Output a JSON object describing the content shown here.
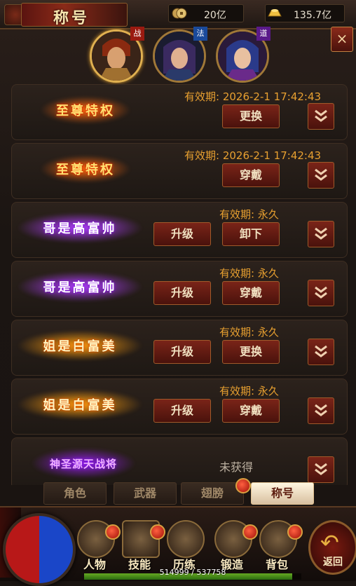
{
  "header": {
    "title": "称号",
    "currencies": [
      {
        "icon": "coin-icon",
        "value": "20亿"
      },
      {
        "icon": "gold-ingot-icon",
        "value": "135.7亿"
      }
    ]
  },
  "characters": [
    {
      "class_tag": "战",
      "tag_color": "#9a1a10",
      "selected": true
    },
    {
      "class_tag": "法",
      "tag_color": "#1a4a9a",
      "selected": false
    },
    {
      "class_tag": "道",
      "tag_color": "#5a1a8a",
      "selected": false
    }
  ],
  "close_label": "×",
  "titles": [
    {
      "badge": "至尊特权",
      "badge_color": "#ff9a20",
      "validity": "有效期: 2026-2-1 17:42:43",
      "upgrade": "",
      "action": "更换",
      "status": ""
    },
    {
      "badge": "至尊特权",
      "badge_color": "#ff9a20",
      "validity": "有效期: 2026-2-1 17:42:43",
      "upgrade": "",
      "action": "穿戴",
      "status": ""
    },
    {
      "badge": "哥是高富帅",
      "badge_color": "#c060ff",
      "validity": "有效期: 永久",
      "upgrade": "升级",
      "action": "卸下",
      "status": ""
    },
    {
      "badge": "哥是高富帅",
      "badge_color": "#c060ff",
      "validity": "有效期: 永久",
      "upgrade": "升级",
      "action": "穿戴",
      "status": ""
    },
    {
      "badge": "姐是白富美",
      "badge_color": "#ffb020",
      "validity": "有效期: 永久",
      "upgrade": "升级",
      "action": "更换",
      "status": ""
    },
    {
      "badge": "姐是白富美",
      "badge_color": "#ffb020",
      "validity": "有效期: 永久",
      "upgrade": "升级",
      "action": "穿戴",
      "status": ""
    },
    {
      "badge": "神圣源天战将",
      "badge_color": "#c040ff",
      "validity": "",
      "upgrade": "",
      "action": "",
      "status": "未获得"
    }
  ],
  "tabs": [
    {
      "label": "角色",
      "active": false
    },
    {
      "label": "武器",
      "active": false
    },
    {
      "label": "翅膀",
      "active": false,
      "alert": true
    },
    {
      "label": "称号",
      "active": true
    }
  ],
  "menu": [
    {
      "label": "人物",
      "icon": "helmet-icon"
    },
    {
      "label": "技能",
      "icon": "skill-book-icon"
    },
    {
      "label": "历练",
      "icon": "armor-icon"
    },
    {
      "label": "锻造",
      "icon": "anvil-icon"
    },
    {
      "label": "背包",
      "icon": "bag-icon"
    }
  ],
  "back_label": "返回",
  "experience": {
    "text": "514999 / 537758",
    "current": 514999,
    "max": 537758
  }
}
